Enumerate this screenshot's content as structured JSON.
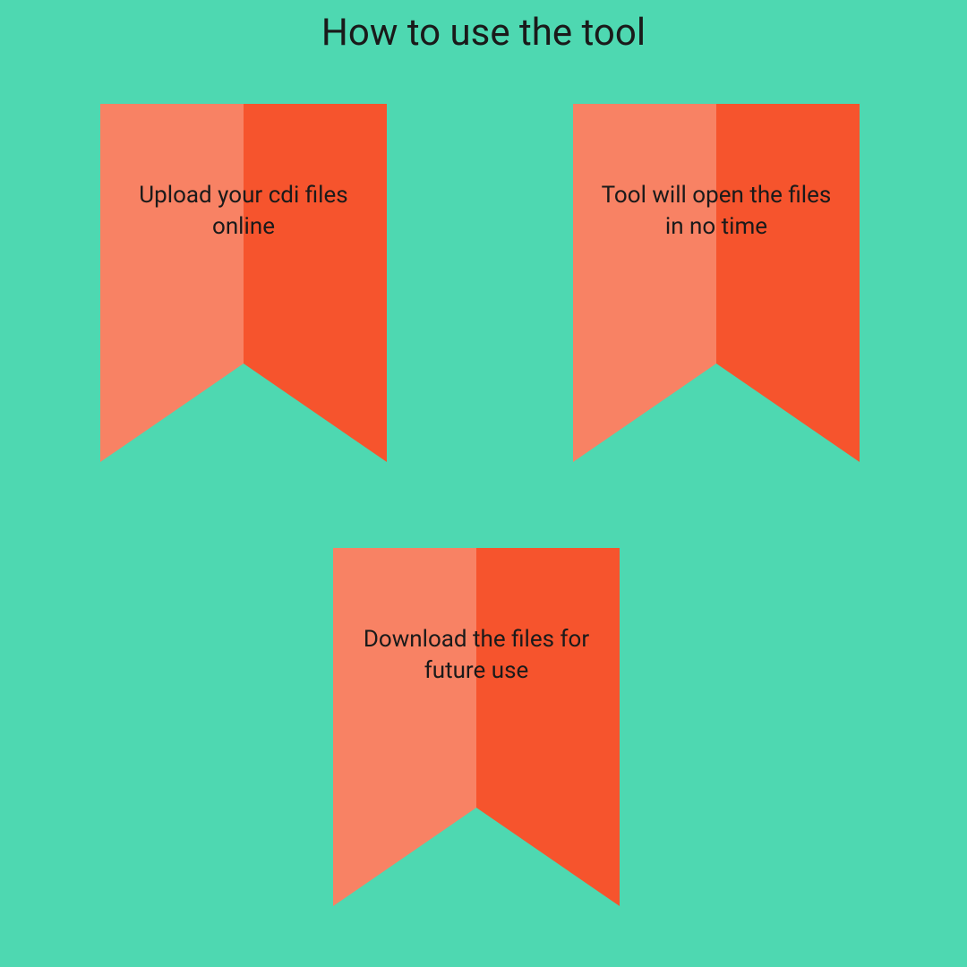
{
  "title": "How to use the tool",
  "ribbons": [
    {
      "text": "Upload your cdi files online"
    },
    {
      "text": "Tool will open the files in no time"
    },
    {
      "text": "Download the files for future use"
    }
  ],
  "colors": {
    "background": "#4ed8b1",
    "ribbonLeft": "#f88264",
    "ribbonRight": "#f6542d",
    "text": "#1a1a1a"
  }
}
